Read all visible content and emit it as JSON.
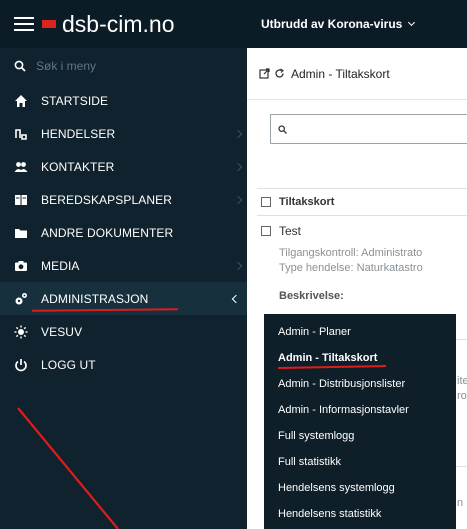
{
  "brand": {
    "name": "dsb-cim.no"
  },
  "topbar": {
    "title": "Utbrudd av Korona-virus"
  },
  "sidebar": {
    "search_placeholder": "Søk i meny",
    "items": [
      {
        "label": "STARTSIDE",
        "icon": "home-icon",
        "has_chevron": false
      },
      {
        "label": "HENDELSER",
        "icon": "hendelser-icon",
        "has_chevron": true
      },
      {
        "label": "KONTAKTER",
        "icon": "contacts-icon",
        "has_chevron": true
      },
      {
        "label": "BEREDSKAPSPLANER",
        "icon": "book-icon",
        "has_chevron": true
      },
      {
        "label": "ANDRE DOKUMENTER",
        "icon": "folder-icon",
        "has_chevron": false
      },
      {
        "label": "MEDIA",
        "icon": "camera-icon",
        "has_chevron": true
      },
      {
        "label": "ADMINISTRASJON",
        "icon": "cogs-icon",
        "has_chevron": true
      },
      {
        "label": "VESUV",
        "icon": "sun-icon",
        "has_chevron": false
      },
      {
        "label": "LOGG UT",
        "icon": "power-icon",
        "has_chevron": false
      }
    ]
  },
  "page": {
    "title": "Admin - Tiltakskort",
    "table_header": "Tiltakskort",
    "row": {
      "title": "Test",
      "meta_line1": "Tilgangskontroll: Administrato",
      "meta_line2": "Type hendelse: Naturkatastro",
      "description_label": "Beskrivelse:"
    },
    "fragments": [
      "ite",
      "ro",
      "n"
    ]
  },
  "submenu": {
    "items": [
      {
        "label": "Admin - Planer",
        "bold": false
      },
      {
        "label": "Admin - Tiltakskort",
        "bold": true
      },
      {
        "label": "Admin - Distribusjonslister",
        "bold": false
      },
      {
        "label": "Admin - Informasjonstavler",
        "bold": false
      },
      {
        "label": "Full systemlogg",
        "bold": false
      },
      {
        "label": "Full statistikk",
        "bold": false
      },
      {
        "label": "Hendelsens systemlogg",
        "bold": false
      },
      {
        "label": "Hendelsens statistikk",
        "bold": false
      }
    ]
  },
  "colors": {
    "sidebar_bg": "#10222d",
    "topbar_bg": "#0c1c26",
    "brand_red": "#d9251c",
    "annotation_red": "#e01b1b"
  }
}
